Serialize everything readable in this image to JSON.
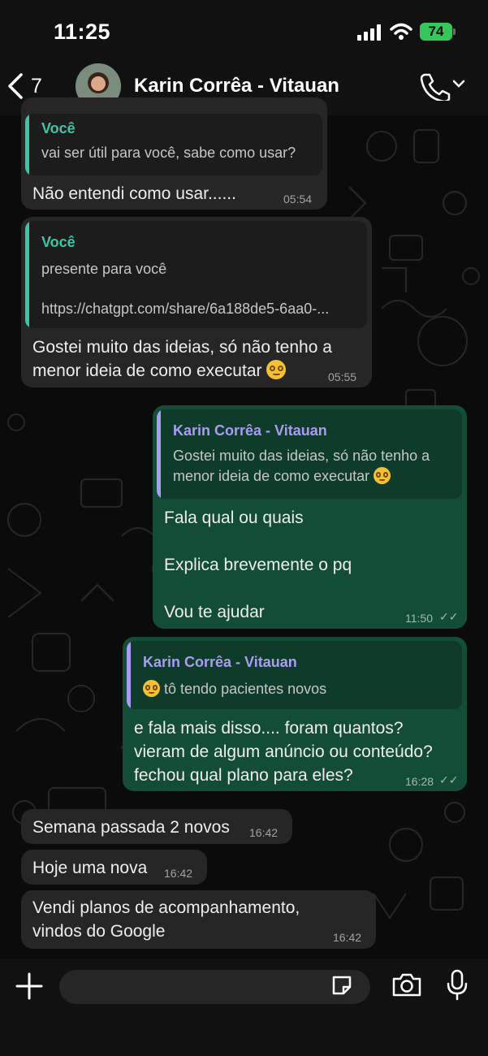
{
  "status_bar": {
    "time": "11:25",
    "battery": "74"
  },
  "header": {
    "back_count": "7",
    "contact_name": "Karin Corrêa - Vitauan"
  },
  "messages": [
    {
      "type": "incoming",
      "quote_author": "Você",
      "quote_lines": [
        "vai ser útil para você, sabe como usar?"
      ],
      "text_lines": [
        "Não entendi como usar......"
      ],
      "time": "05:54"
    },
    {
      "type": "incoming",
      "quote_author": "Você",
      "quote_lines": [
        "presente para você",
        "",
        "https://chatgpt.com/share/6a188de5-6aa0-..."
      ],
      "text_lines": [
        "Gostei muito das ideias, só não tenho a",
        "menor ideia de como executar"
      ],
      "time": "05:55"
    },
    {
      "type": "outgoing",
      "quote_author": "Karin Corrêa - Vitauan",
      "quote_lines": [
        "Gostei muito das ideias, só não tenho a",
        "menor ideia de como executar"
      ],
      "text_lines": [
        "Fala qual ou quais",
        "",
        "Explica brevemente o pq",
        "",
        "Vou te ajudar"
      ],
      "time": "11:50"
    },
    {
      "type": "outgoing",
      "quote_author": "Karin Corrêa - Vitauan",
      "quote_lines": [
        "tô tendo pacientes novos"
      ],
      "text_lines": [
        "e fala mais disso.... foram quantos?",
        "vieram de algum anúncio ou conteúdo?",
        "fechou qual plano para eles?"
      ],
      "time": "16:28"
    },
    {
      "type": "incoming",
      "text_lines": [
        "Semana passada 2 novos"
      ],
      "time": "16:42"
    },
    {
      "type": "incoming",
      "text_lines": [
        "Hoje uma nova"
      ],
      "time": "16:42"
    },
    {
      "type": "incoming",
      "text_lines": [
        "Vendi planos de acompanhamento,",
        "vindos do Google"
      ],
      "time": "16:42"
    }
  ],
  "composer": {
    "placeholder": ""
  },
  "colors": {
    "quote_self": "#3fc5a4",
    "quote_contact": "#a99cf2",
    "outgoing_bubble": "#144d37",
    "incoming_bubble": "#262626"
  }
}
